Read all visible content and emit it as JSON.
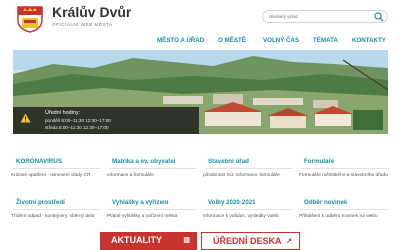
{
  "header": {
    "title": "Králův Dvůr",
    "subtitle": "OFICIÁLNÍ WEB MĚSTA",
    "search_placeholder": "Hledaný výraz"
  },
  "nav": [
    "MĚSTO A ÚŘAD",
    "O MĚSTĚ",
    "VOLNÝ ČAS",
    "TÉMATA",
    "KONTAKTY"
  ],
  "notice": {
    "title": "Úřední hodiny:",
    "line1": "pondělí  8:00–11:30  12:30–17:00",
    "line2": "středa    8:00–11:30  12:30–17:00"
  },
  "cards": [
    {
      "title": "KORONAVIRUS",
      "desc": "Krizové opatření - usnesení vlády ČR"
    },
    {
      "title": "Matrika a ev. obyvatel",
      "desc": "Informace a formuláře"
    },
    {
      "title": "Stavební úřad",
      "desc": "působnost SÚ, informace, formuláře"
    },
    {
      "title": "Formuláře",
      "desc": "Formuláře městského a stavebního úřadu"
    },
    {
      "title": "Životní prostředí",
      "desc": "Třídění odpad - kontejnery, sběrný dvůr"
    },
    {
      "title": "Vyhlášky a vyřízení",
      "desc": "Platné vyhlášky a nařízení města"
    },
    {
      "title": "Volby 2020-2021",
      "desc": "Informace k volbám, výsledky voleb"
    },
    {
      "title": "Odběr novinek",
      "desc": "Přihlášení k odběru novinek na webu"
    }
  ],
  "buttons": {
    "news": "AKTUALITY",
    "board": "ÚŘEDNÍ DESKA"
  },
  "colors": {
    "accent": "#1a8ea3",
    "red": "#c7342f"
  },
  "icons": {
    "search": "search-icon",
    "warning": "warning-icon",
    "news": "news-icon",
    "board": "external-link-icon"
  }
}
